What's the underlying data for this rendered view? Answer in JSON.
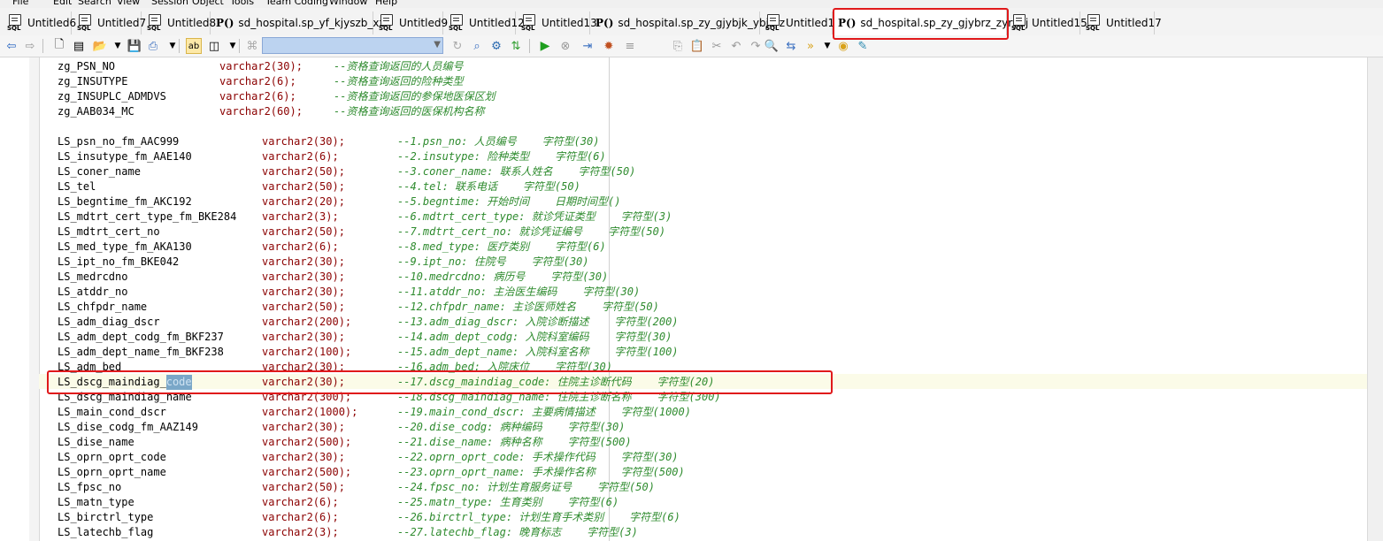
{
  "menu": [
    "File",
    "Edit",
    "Search",
    "View",
    "Session",
    "Object",
    "Tools",
    "Team Coding",
    "Window",
    "Help"
  ],
  "tabs": [
    {
      "label": "Untitled6",
      "icon": "sql-file-icon",
      "icon_text": "SQL"
    },
    {
      "label": "Untitled7",
      "icon": "sql-file-icon",
      "icon_text": "SQL"
    },
    {
      "label": "Untitled8",
      "icon": "sql-file-icon",
      "icon_text": "SQL"
    },
    {
      "label": "sd_hospital.sp_yf_kjyszb_xzh",
      "icon": "procedure-icon",
      "icon_text": "P()"
    },
    {
      "label": "Untitled9",
      "icon": "sql-file-icon",
      "icon_text": "SQL"
    },
    {
      "label": "Untitled12",
      "icon": "sql-file-icon",
      "icon_text": "SQL"
    },
    {
      "label": "Untitled13",
      "icon": "sql-file-icon",
      "icon_text": "SQL"
    },
    {
      "label": "sd_hospital.sp_zy_gjybjk_ybjkrz",
      "icon": "procedure-icon",
      "icon_text": "P()"
    },
    {
      "label": "Untitled14",
      "icon": "sql-file-icon",
      "icon_text": "SQL"
    },
    {
      "label": "sd_hospital.sp_zy_gjybrz_zyrydj",
      "icon": "procedure-icon",
      "icon_text": "P()",
      "active": true
    },
    {
      "label": "Untitled15",
      "icon": "sql-file-icon",
      "icon_text": "SQL"
    },
    {
      "label": "Untitled17",
      "icon": "sql-file-icon",
      "icon_text": "SQL"
    }
  ],
  "code_lines": [
    {
      "name": "zg_PSN_NO",
      "type": "varchar2(30);",
      "comment": "--资格查询返回的人员编号"
    },
    {
      "name": "zg_INSUTYPE",
      "type": "varchar2(6);",
      "comment": "--资格查询返回的险种类型"
    },
    {
      "name": "zg_INSUPLC_ADMDVS",
      "type": "varchar2(6);",
      "comment": "--资格查询返回的参保地医保区划"
    },
    {
      "name": "zg_AAB034_MC",
      "type": "varchar2(60);",
      "comment": "--资格查询返回的医保机构名称"
    },
    {
      "name": "",
      "type": "",
      "comment": ""
    },
    {
      "name": "LS_psn_no_fm_AAC999",
      "type": "varchar2(30);",
      "comment": "--1.psn_no: 人员编号    字符型(30)"
    },
    {
      "name": "LS_insutype_fm_AAE140",
      "type": "varchar2(6);",
      "comment": "--2.insutype: 险种类型    字符型(6)"
    },
    {
      "name": "LS_coner_name",
      "type": "varchar2(50);",
      "comment": "--3.coner_name: 联系人姓名    字符型(50)"
    },
    {
      "name": "LS_tel",
      "type": "varchar2(50);",
      "comment": "--4.tel: 联系电话    字符型(50)"
    },
    {
      "name": "LS_begntime_fm_AKC192",
      "type": "varchar2(20);",
      "comment": "--5.begntime: 开始时间    日期时间型()"
    },
    {
      "name": "LS_mdtrt_cert_type_fm_BKE284",
      "type": "varchar2(3);",
      "comment": "--6.mdtrt_cert_type: 就诊凭证类型    字符型(3)"
    },
    {
      "name": "LS_mdtrt_cert_no",
      "type": "varchar2(50);",
      "comment": "--7.mdtrt_cert_no: 就诊凭证编号    字符型(50)"
    },
    {
      "name": "LS_med_type_fm_AKA130",
      "type": "varchar2(6);",
      "comment": "--8.med_type: 医疗类别    字符型(6)"
    },
    {
      "name": "LS_ipt_no_fm_BKE042",
      "type": "varchar2(30);",
      "comment": "--9.ipt_no: 住院号    字符型(30)"
    },
    {
      "name": "LS_medrcdno",
      "type": "varchar2(30);",
      "comment": "--10.medrcdno: 病历号    字符型(30)"
    },
    {
      "name": "LS_atddr_no",
      "type": "varchar2(30);",
      "comment": "--11.atddr_no: 主治医生编码    字符型(30)"
    },
    {
      "name": "LS_chfpdr_name",
      "type": "varchar2(50);",
      "comment": "--12.chfpdr_name: 主诊医师姓名    字符型(50)"
    },
    {
      "name": "LS_adm_diag_dscr",
      "type": "varchar2(200);",
      "comment": "--13.adm_diag_dscr: 入院诊断描述    字符型(200)"
    },
    {
      "name": "LS_adm_dept_codg_fm_BKF237",
      "type": "varchar2(30);",
      "comment": "--14.adm_dept_codg: 入院科室编码    字符型(30)"
    },
    {
      "name": "LS_adm_dept_name_fm_BKF238",
      "type": "varchar2(100);",
      "comment": "--15.adm_dept_name: 入院科室名称    字符型(100)"
    },
    {
      "name": "LS_adm_bed",
      "type": "varchar2(30);",
      "comment": "--16.adm_bed: 入院床位    字符型(30)"
    },
    {
      "name": "LS_dscg_maindiag_",
      "sel": "code",
      "type": "varchar2(30);",
      "comment": "--17.dscg_maindiag_code: 住院主诊断代码    字符型(20)"
    },
    {
      "name": "LS_dscg_maindiag_name",
      "type": "varchar2(300);",
      "comment": "--18.dscg_maindiag_name: 住院主诊断名称    字符型(300)"
    },
    {
      "name": "LS_main_cond_dscr",
      "type": "varchar2(1000);",
      "comment": "--19.main_cond_dscr: 主要病情描述    字符型(1000)"
    },
    {
      "name": "LS_dise_codg_fm_AAZ149",
      "type": "varchar2(30);",
      "comment": "--20.dise_codg: 病种编码    字符型(30)"
    },
    {
      "name": "LS_dise_name",
      "type": "varchar2(500);",
      "comment": "--21.dise_name: 病种名称    字符型(500)"
    },
    {
      "name": "LS_oprn_oprt_code",
      "type": "varchar2(30);",
      "comment": "--22.oprn_oprt_code: 手术操作代码    字符型(30)"
    },
    {
      "name": "LS_oprn_oprt_name",
      "type": "varchar2(500);",
      "comment": "--23.oprn_oprt_name: 手术操作名称    字符型(500)"
    },
    {
      "name": "LS_fpsc_no",
      "type": "varchar2(50);",
      "comment": "--24.fpsc_no: 计划生育服务证号    字符型(50)"
    },
    {
      "name": "LS_matn_type",
      "type": "varchar2(6);",
      "comment": "--25.matn_type: 生育类别    字符型(6)"
    },
    {
      "name": "LS_birctrl_type",
      "type": "varchar2(6);",
      "comment": "--26.birctrl_type: 计划生育手术类别    字符型(6)"
    },
    {
      "name": "LS_latechb_flag",
      "type": "varchar2(3);",
      "comment": "--27.latechb_flag: 晚育标志    字符型(3)"
    }
  ],
  "colors": {
    "keyword": "#8b0000",
    "comment": "#2e8b2e",
    "highlight_box": "#e0191b",
    "selection": "#7aa7c8"
  }
}
